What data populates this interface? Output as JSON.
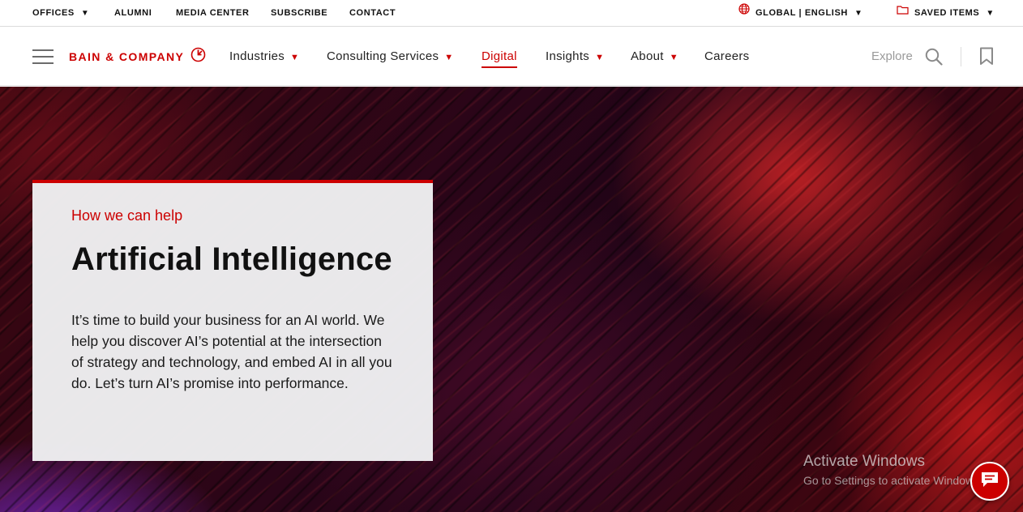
{
  "utility": {
    "offices": "OFFICES",
    "alumni": "ALUMNI",
    "media_center": "MEDIA CENTER",
    "subscribe": "SUBSCRIBE",
    "contact": "CONTACT",
    "region": "GLOBAL | ENGLISH",
    "saved_items": "SAVED ITEMS",
    "caret": "▼"
  },
  "nav": {
    "logo": "BAIN & COMPANY",
    "industries": "Industries",
    "consulting": "Consulting Services",
    "digital": "Digital",
    "insights": "Insights",
    "about": "About",
    "careers": "Careers",
    "explore": "Explore",
    "caret": "▼"
  },
  "hero": {
    "eyebrow": "How we can help",
    "title": "Artificial Intelligence",
    "body": "It’s time to build your business for an AI world. We help you discover AI’s potential at the intersection of strategy and technology, and embed AI in all you do. Let’s turn AI’s promise into performance."
  },
  "watermark": {
    "title": "Activate Windows",
    "subtitle": "Go to Settings to activate Windows."
  },
  "colors": {
    "brand_red": "#cc0000",
    "text_dark": "#111111",
    "muted": "#9a9a9a"
  },
  "icons": {
    "menu": "hamburger-icon",
    "globe": "globe-icon",
    "folder": "folder-icon",
    "search": "search-icon",
    "bookmark": "bookmark-icon",
    "chat": "chat-icon"
  }
}
